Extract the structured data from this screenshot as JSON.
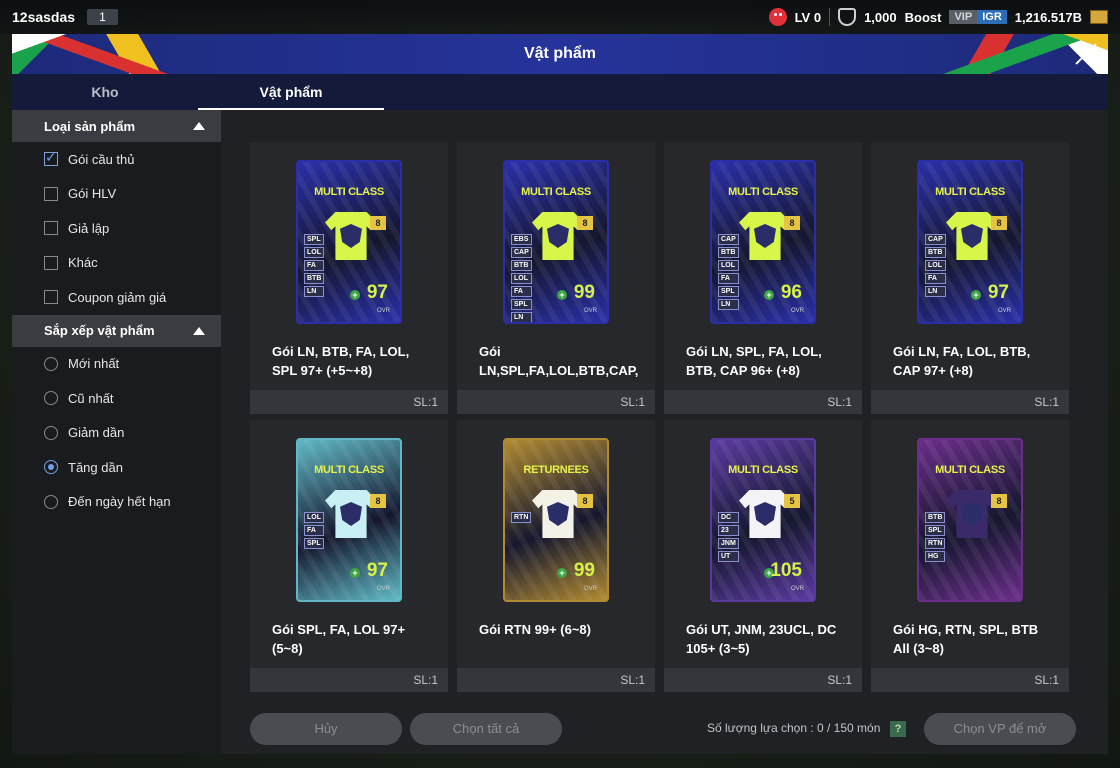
{
  "hud": {
    "username": "12sasdas",
    "slot": "1",
    "level": "LV 0",
    "points": "1,000",
    "boost_label": "Boost",
    "vip_label": "VIP",
    "igr_label": "IGR",
    "currency": "1,216.517B"
  },
  "modal": {
    "title": "Vật phẩm",
    "tabs": [
      "Kho",
      "Vật phẩm"
    ]
  },
  "sidebar": {
    "filter_header": "Loại sản phẩm",
    "filters": [
      {
        "label": "Gói cầu thủ",
        "checked": true
      },
      {
        "label": "Gói HLV",
        "checked": false
      },
      {
        "label": "Giả lập",
        "checked": false
      },
      {
        "label": "Khác",
        "checked": false
      },
      {
        "label": "Coupon giảm giá",
        "checked": false
      }
    ],
    "sort_header": "Sắp xếp vật phẩm",
    "sorts": [
      {
        "label": "Mới nhất",
        "selected": false
      },
      {
        "label": "Cũ nhất",
        "selected": false
      },
      {
        "label": "Giảm dần",
        "selected": false
      },
      {
        "label": "Tăng dần",
        "selected": true
      },
      {
        "label": "Đến ngày hết hạn",
        "selected": false
      }
    ]
  },
  "items": [
    {
      "title": "MULTI CLASS",
      "level": "8",
      "tags": [
        "SPL",
        "LOL",
        "FA",
        "BTB",
        "LN"
      ],
      "ovr": "97",
      "ovr_label": "OVR",
      "name": "Gói LN, BTB, FA, LOL, SPL 97+ (+5~+8)",
      "qty": "SL:1",
      "theme": "#2a2fa8",
      "accent": "#d8f54a"
    },
    {
      "title": "MULTI CLASS",
      "level": "8",
      "tags": [
        "EBS",
        "CAP",
        "BTB",
        "LOL",
        "FA",
        "SPL",
        "LN"
      ],
      "ovr": "99",
      "ovr_label": "OVR",
      "name": "Gói LN,SPL,FA,LOL,BTB,CAP,",
      "qty": "SL:1",
      "theme": "#2a2fa8",
      "accent": "#d8f54a"
    },
    {
      "title": "MULTI CLASS",
      "level": "8",
      "tags": [
        "CAP",
        "BTB",
        "LOL",
        "FA",
        "SPL",
        "LN"
      ],
      "ovr": "96",
      "ovr_label": "OVR",
      "name": "Gói LN, SPL, FA, LOL, BTB, CAP 96+ (+8)",
      "qty": "SL:1",
      "theme": "#2a2fa8",
      "accent": "#d8f54a"
    },
    {
      "title": "MULTI CLASS",
      "level": "8",
      "tags": [
        "CAP",
        "BTB",
        "LOL",
        "FA",
        "LN"
      ],
      "ovr": "97",
      "ovr_label": "OVR",
      "name": "Gói LN, FA, LOL, BTB, CAP 97+ (+8)",
      "qty": "SL:1",
      "theme": "#2a2fa8",
      "accent": "#d8f54a"
    },
    {
      "title": "MULTI CLASS",
      "level": "8",
      "tags": [
        "LOL",
        "FA",
        "SPL"
      ],
      "ovr": "97",
      "ovr_label": "OVR",
      "name": "Gói SPL, FA, LOL 97+ (5~8)",
      "qty": "SL:1",
      "theme": "#5fb8c4",
      "accent": "#c8f0f4"
    },
    {
      "title": "RETURNEES",
      "level": "8",
      "tags": [
        "RTN"
      ],
      "ovr": "99",
      "ovr_label": "OVR",
      "name": "Gói RTN 99+ (6~8)",
      "qty": "SL:1",
      "theme": "#b08930",
      "accent": "#f4f1e6"
    },
    {
      "title": "MULTI CLASS",
      "level": "5",
      "tags": [
        "DC",
        "23",
        "JNM",
        "UT"
      ],
      "ovr": "105",
      "ovr_label": "OVR",
      "name": "Gói UT, JNM, 23UCL, DC 105+ (3~5)",
      "qty": "SL:1",
      "theme": "#5a3aa0",
      "accent": "#f4f4f6"
    },
    {
      "title": "MULTI CLASS",
      "level": "8",
      "tags": [
        "BTB",
        "SPL",
        "RTN",
        "HG"
      ],
      "ovr": "",
      "ovr_label": "",
      "name": "Gói HG, RTN, SPL, BTB All (3~8)",
      "qty": "SL:1",
      "theme": "#6a2d8a",
      "accent": "#3a2a6a"
    }
  ],
  "footer": {
    "cancel_label": "Hủy",
    "select_all_label": "Chọn tất cả",
    "selection_text": "Số lượng lựa chọn : 0 / 150 món",
    "help_label": "?",
    "open_label": "Chọn VP để mở"
  }
}
